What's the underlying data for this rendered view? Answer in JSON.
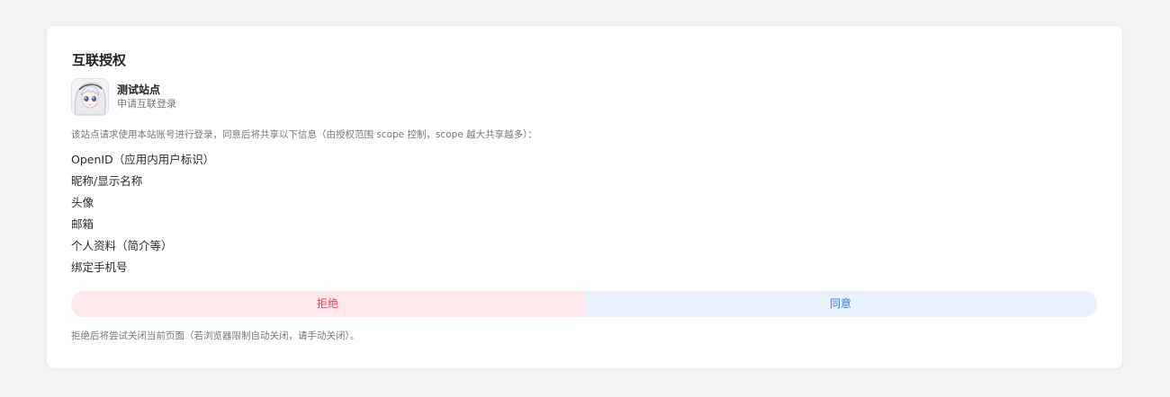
{
  "title": "互联授权",
  "site": {
    "name": "测试站点",
    "subtitle": "申请互联登录",
    "avatar_icon": "anime-character-avatar"
  },
  "description": "该站点请求使用本站账号进行登录，同意后将共享以下信息（由授权范围 scope 控制，scope 越大共享越多）：",
  "scopes": [
    "OpenID（应用内用户标识）",
    "昵称/显示名称",
    "头像",
    "邮箱",
    "个人资料（简介等）",
    "绑定手机号"
  ],
  "actions": {
    "deny_label": "拒绝",
    "allow_label": "同意"
  },
  "footnote": "拒绝后将尝试关闭当前页面（若浏览器限制自动关闭，请手动关闭）。",
  "colors": {
    "deny_bg": "#fde8ec",
    "deny_text": "#e0445e",
    "allow_bg": "#e9f1fd",
    "allow_text": "#3a7fe0"
  }
}
